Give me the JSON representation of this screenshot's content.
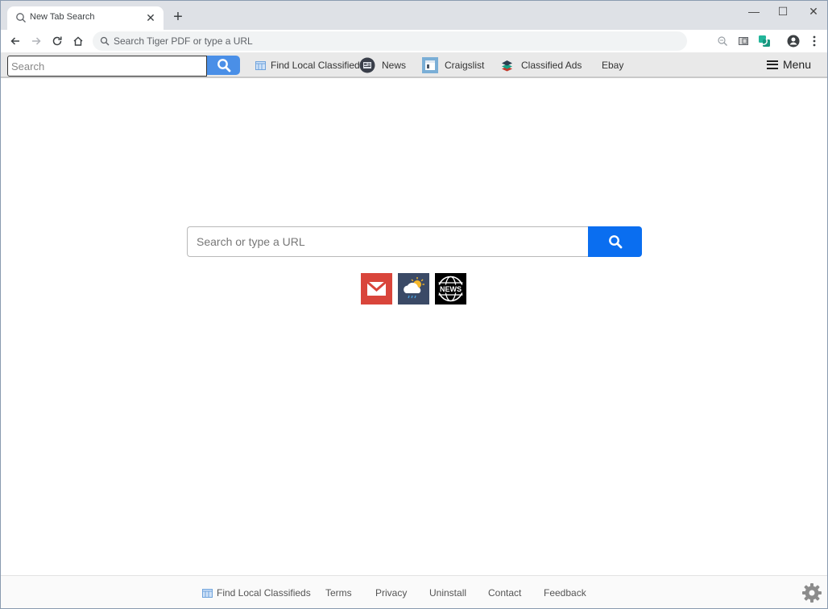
{
  "browser": {
    "tab": {
      "title": "New Tab Search",
      "icon": "search-icon"
    },
    "new_tab_label": "+",
    "window_controls": {
      "minimize": "—",
      "maximize": "☐",
      "close": "✕"
    },
    "omnibox": {
      "placeholder": "Search Tiger PDF or type a URL",
      "value": ""
    },
    "nav": [
      "back-icon",
      "forward-icon",
      "reload-icon",
      "home-icon"
    ],
    "extensions": [
      "zoom-icon",
      "reader-icon",
      "extension-green-icon",
      "profile-icon",
      "more-icon"
    ]
  },
  "toolbar": {
    "search_placeholder": "Search",
    "links": [
      {
        "label": "Find Local Classifieds",
        "icon": "classifieds-icon"
      },
      {
        "label": "News",
        "icon": "news-icon"
      },
      {
        "label": "Craigslist",
        "icon": "craigslist-icon"
      },
      {
        "label": "Classified Ads",
        "icon": "stack-icon"
      },
      {
        "label": "Ebay",
        "icon": ""
      }
    ],
    "menu_label": "Menu"
  },
  "main": {
    "search_placeholder": "Search or type a URL",
    "search_value": "",
    "quick_links": [
      {
        "name": "Gmail",
        "icon": "mail-icon",
        "color": "#d9453b"
      },
      {
        "name": "Weather",
        "icon": "weather-icon",
        "color": "#3b4a66"
      },
      {
        "name": "News",
        "icon": "news-globe-icon",
        "color": "#000000"
      }
    ]
  },
  "footer": {
    "links": [
      {
        "label": "Find Local Classifieds",
        "icon": "classifieds-icon"
      },
      {
        "label": "Terms"
      },
      {
        "label": "Privacy"
      },
      {
        "label": "Uninstall"
      },
      {
        "label": "Contact"
      },
      {
        "label": "Feedback"
      }
    ],
    "settings_icon": "gear-icon"
  },
  "colors": {
    "accent": "#0a6ef0",
    "toolbar_search_button": "#4a8fe7",
    "tabstrip": "#dee1e6",
    "toolbar_bg": "#e9e9e9"
  }
}
